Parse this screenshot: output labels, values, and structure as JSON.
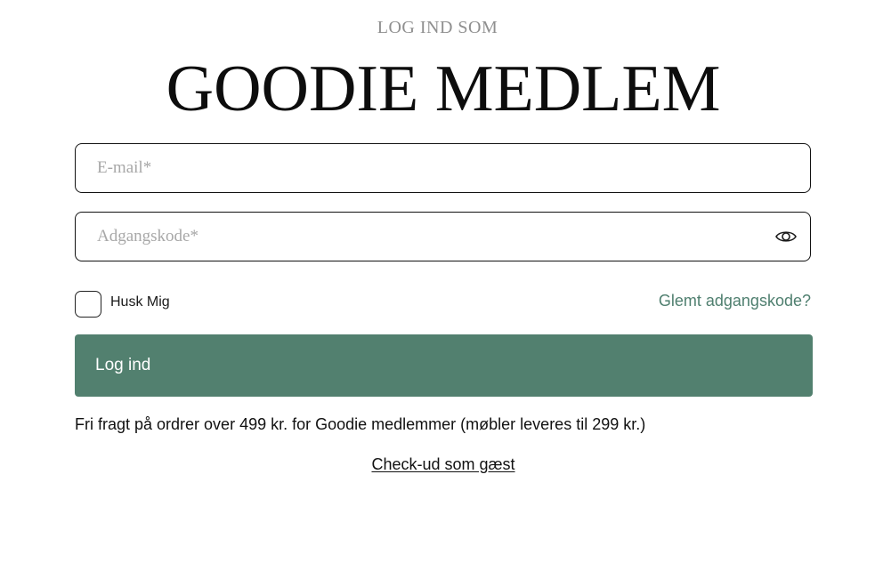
{
  "header": {
    "subtitle": "LOG IND SOM",
    "title": "GOODIE MEDLEM"
  },
  "form": {
    "email": {
      "placeholder": "E-mail*",
      "value": ""
    },
    "password": {
      "placeholder": "Adgangskode*",
      "value": "",
      "toggle_icon": "eye-icon"
    },
    "remember_label": "Husk Mig",
    "remember_checked": false,
    "forgot_label": "Glemt adgangskode?",
    "submit_label": "Log ind"
  },
  "shipping_note": "Fri fragt på ordrer over 499 kr. for Goodie medlemmer (møbler leveres til 299 kr.)",
  "guest_checkout_label": "Check-ud som gæst",
  "colors": {
    "accent": "#52806f",
    "link": "#4f7f6f",
    "placeholder": "#a8a8a8",
    "subtitle": "#8f8f8f"
  }
}
